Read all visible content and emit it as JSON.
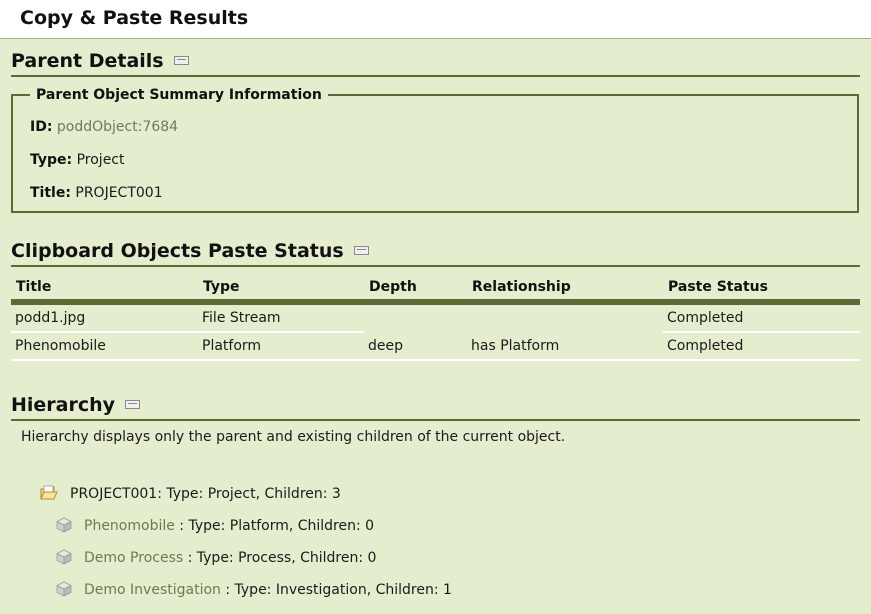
{
  "page": {
    "title": "Copy & Paste Results"
  },
  "parent_details": {
    "heading": "Parent Details",
    "summary_legend": "Parent Object Summary Information",
    "id_label": "ID:",
    "id_value": "poddObject:7684",
    "type_label": "Type:",
    "type_value": "Project",
    "title_label": "Title:",
    "title_value": "PROJECT001"
  },
  "paste_status": {
    "heading": "Clipboard Objects Paste Status",
    "columns": [
      "Title",
      "Type",
      "Depth",
      "Relationship",
      "Paste Status"
    ],
    "rows": [
      [
        "podd1.jpg",
        "File Stream",
        "",
        "",
        "Completed"
      ],
      [
        "Phenomobile",
        "Platform",
        "deep",
        "has Platform",
        "Completed"
      ]
    ]
  },
  "hierarchy": {
    "heading": "Hierarchy",
    "description": "Hierarchy displays only the parent and existing children of the current object.",
    "root": {
      "text": "PROJECT001: Type: Project, Children: 3",
      "icon": "folder-icon"
    },
    "children": [
      {
        "name": "Phenomobile",
        "detail": " : Type: Platform, Children: 0",
        "icon": "cube-icon"
      },
      {
        "name": "Demo Process",
        "detail": " : Type: Process, Children: 0",
        "icon": "cube-icon"
      },
      {
        "name": "Demo Investigation",
        "detail": " : Type: Investigation, Children: 1",
        "icon": "cube-icon"
      }
    ]
  },
  "colors": {
    "panel_background": "#e5edcf",
    "rule": "#5b6b35",
    "link": "#6e7a4c"
  }
}
